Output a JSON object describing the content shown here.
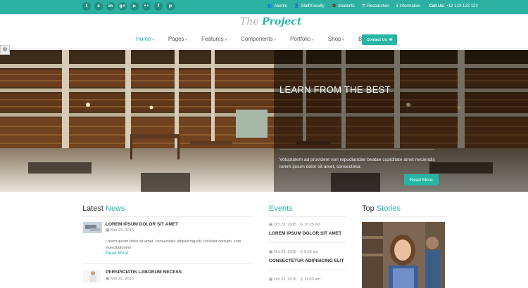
{
  "topbar": {
    "social_icons": [
      "twitter-icon",
      "skype-icon",
      "linkedin-icon",
      "googleplus-icon",
      "youtube-icon",
      "flickr-icon",
      "facebook-icon",
      "pinterest-icon"
    ],
    "social_glyphs": [
      "t",
      "s",
      "in",
      "g+",
      "▶",
      "••",
      "f",
      "p"
    ],
    "links": [
      {
        "icon": "users-icon",
        "glyph": "👥",
        "label": "Alumni"
      },
      {
        "icon": "user-icon",
        "glyph": "👤",
        "label": "Staff/Faculty"
      },
      {
        "icon": "student-icon",
        "glyph": "🎓",
        "label": "Students"
      },
      {
        "icon": "research-icon",
        "glyph": "⚗",
        "label": "Researches"
      },
      {
        "icon": "info-icon",
        "glyph": "ℹ",
        "label": "Information"
      }
    ],
    "call_label": "Call Us:",
    "call_number": "+12 123 123 123"
  },
  "header": {
    "logo_the": "The",
    "logo_project": "Project",
    "nav": [
      {
        "label": "Home",
        "active": true
      },
      {
        "label": "Pages",
        "active": false
      },
      {
        "label": "Features",
        "active": false
      },
      {
        "label": "Components",
        "active": false
      },
      {
        "label": "Portfolio",
        "active": false
      },
      {
        "label": "Shop",
        "active": false
      },
      {
        "label": "Blog",
        "active": false
      }
    ],
    "contact_label": "Contact Us",
    "contact_icon": "envelope-icon"
  },
  "hero": {
    "title": "LEARN FROM THE BEST",
    "text": "Voluptatem ad provident non repudiandae beatae cupiditate amet reiciendis lorem ipsum dolor sit amet, consectetur.",
    "button": "Read More"
  },
  "latest_news": {
    "title_a": "Latest",
    "title_b": "News",
    "items": [
      {
        "title": "LOREM IPSUM DOLOR SIT AMET",
        "date": "Mar 23, 2015",
        "text": "Lorem ipsum dolor sit amet, consectetur adipisicing elit. Incidunt corrupti, cum exercitationem",
        "more": "Read More"
      },
      {
        "title": "PERSPICIATIS LABORUM NECESS",
        "date": "Mar 22, 2015"
      }
    ]
  },
  "events": {
    "title": "Events",
    "items": [
      {
        "date": "Oct 23, 2015",
        "time": "10:25 am",
        "title": "LOREM IPSUM DOLOR SIT AMET"
      },
      {
        "date": "Oct 23, 2015",
        "time": "9:55 am",
        "title": "CONSECTETUR ADIPISICING ELIT"
      },
      {
        "date": "Oct 23, 2015",
        "time": "11:05 am"
      }
    ]
  },
  "top_stories": {
    "title_a": "Top",
    "title_b": "Stories"
  },
  "colors": {
    "accent": "#27b5a3",
    "topbar": "#2bb0a1"
  }
}
